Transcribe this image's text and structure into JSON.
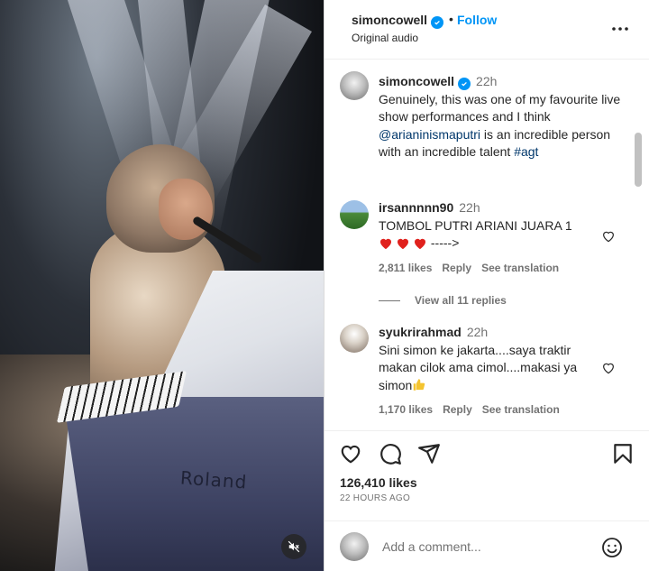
{
  "post": {
    "author": "simoncowell",
    "follow_label": "Follow",
    "dot": "•",
    "audio": "Original audio",
    "media_brand": "Roland"
  },
  "caption": {
    "username": "simoncowell",
    "time": "22h",
    "text_before": "Genuinely, this was one of my favourite live show performances and I think ",
    "mention": "@arianinismaputri",
    "text_middle": " is an incredible person with an incredible talent ",
    "hashtag": "#agt"
  },
  "comments": [
    {
      "username": "irsannnnn90",
      "time": "22h",
      "text": "TOMBOL PUTRI ARIANI JUARA 1",
      "text_line2": " ----->",
      "likes": "2,811 likes",
      "reply": "Reply",
      "translate": "See translation"
    },
    {
      "username": "syukrirahmad",
      "time": "22h",
      "text": "Sini simon ke jakarta....saya traktir makan cilok ama cimol....makasi ya simon",
      "likes": "1,170 likes",
      "reply": "Reply",
      "translate": "See translation"
    }
  ],
  "view_replies": "View all 11 replies",
  "likes_count": "126,410 likes",
  "posted_ago": "22 HOURS AGO",
  "add_comment": {
    "placeholder": "Add a comment..."
  },
  "colors": {
    "accent": "#0095f6",
    "heart": "#ed4956",
    "muted": "#737373",
    "link": "#00376b"
  },
  "icons": [
    "more-options-icon",
    "verified-badge-icon",
    "heart-icon",
    "comment-icon",
    "share-icon",
    "bookmark-icon",
    "mute-icon",
    "emoji-icon",
    "thumbs-up-emoji"
  ]
}
